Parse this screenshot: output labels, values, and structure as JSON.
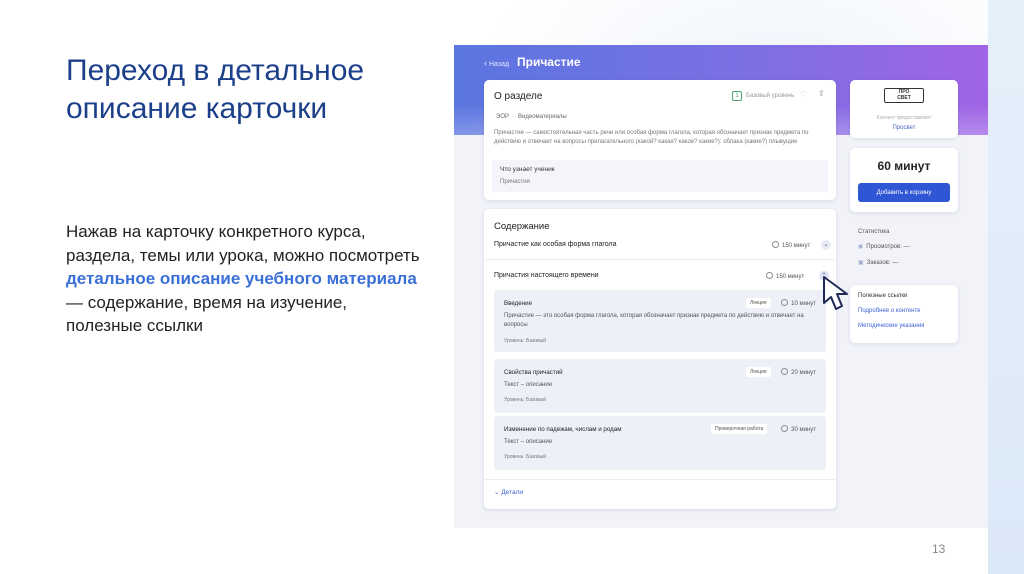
{
  "slide": {
    "title": "Переход в детальное описание карточки",
    "body_before": "Нажав на карточку конкретного курса, раздела, темы или урока, можно посмотреть ",
    "body_highlight": "детальное описание учебного материала",
    "body_after": " — содержание, время на изучение, полезные ссылки",
    "page_number": "13"
  },
  "screen": {
    "back_label": "Назад",
    "title": "Причастие",
    "about": {
      "title": "О разделе",
      "level_mark": "1",
      "level_label": "Базовый уровень",
      "tags": [
        "ЭОР",
        "Видеоматериалы"
      ],
      "description": "Причастие — самостоятельная часть речи или особая форма глагола, которая обозначает признак предмета по действию и отвечает на вопросы прилагательного (какой? какая? какое? какие?): облака (какие?) плывущие",
      "learn_title": "Что узнает ученик",
      "learn_value": "Причастия"
    },
    "provider": {
      "logo_line1": "ПРО",
      "logo_line2": "СВЕТ",
      "note": "Контент предоставляет",
      "name": "Просвет"
    },
    "price": {
      "duration": "60 минут",
      "cart_button": "Добавить в корзину"
    },
    "stats": {
      "title": "Статистика",
      "views": "Просмотров: —",
      "orders": "Заказов: —"
    },
    "links": {
      "title": "Полезные ссылки",
      "items": [
        "Подробнее о контенте",
        "Методические указания"
      ]
    },
    "content": {
      "title": "Содержание",
      "rows": [
        {
          "title": "Причастие как особая форма глагола",
          "time": "150 минут"
        },
        {
          "title": "Причастия настоящего времени",
          "time": "150 минут"
        }
      ],
      "lessons": [
        {
          "title": "Введение",
          "type": "Лекция",
          "time": "10 минут",
          "desc": "Причастие — это особая форма глагола, которая обозначает признак предмета по действию и отвечает на вопросы",
          "level": "Уровень: Базовый"
        },
        {
          "title": "Свойства причастий",
          "type": "Лекция",
          "time": "20 минут",
          "desc": "Текст – описание",
          "level": "Уровень: Базовый"
        },
        {
          "title": "Изменение по падежам, числам и родам",
          "type": "Проверочная работа",
          "time": "30 минут",
          "desc": "Текст – описание",
          "level": "Уровень: Базовый"
        }
      ],
      "details_label": "Детали"
    }
  },
  "icons": {
    "back": "chevron-left-icon",
    "like": "heart-icon",
    "share": "share-icon",
    "clock": "clock-icon",
    "expand": "chevron-down-icon",
    "pointer": "mouse-pointer-icon"
  },
  "colors": {
    "title_blue": "#1c3f8a",
    "highlight_blue": "#3a6fd8",
    "button_blue": "#2f56d4",
    "header_gradient_start": "#5a76e0",
    "header_gradient_end": "#a064e6"
  }
}
